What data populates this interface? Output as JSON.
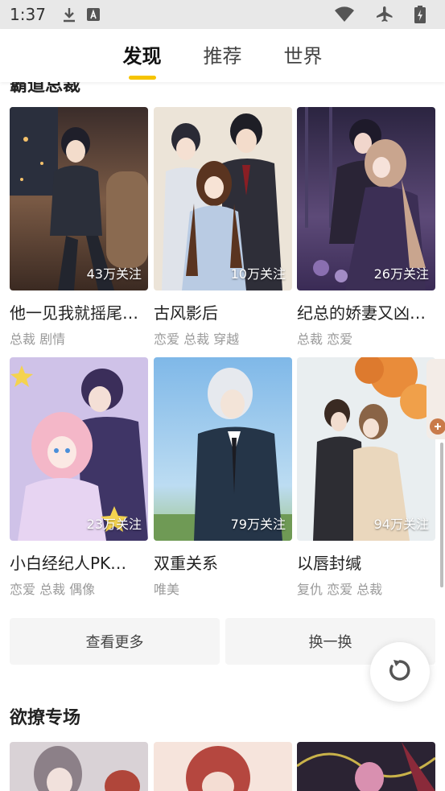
{
  "status_bar": {
    "time": "1:37"
  },
  "tabs": [
    {
      "label": "发现",
      "active": true
    },
    {
      "label": "推荐",
      "active": false
    },
    {
      "label": "世界",
      "active": false
    }
  ],
  "clipped_section_title": "霸道总裁",
  "cards": [
    {
      "title": "他一见我就摇尾…",
      "tags": "总裁 剧情",
      "follows": "43万关注"
    },
    {
      "title": "古风影后",
      "tags": "恋爱 总裁 穿越",
      "follows": "10万关注"
    },
    {
      "title": "纪总的娇妻又凶…",
      "tags": "总裁 恋爱",
      "follows": "26万关注"
    },
    {
      "title": "小白经纪人PK…",
      "tags": "恋爱 总裁 偶像",
      "follows": "23万关注"
    },
    {
      "title": "双重关系",
      "tags": "唯美",
      "follows": "79万关注"
    },
    {
      "title": "以唇封缄",
      "tags": "复仇 恋爱 总裁",
      "follows": "94万关注"
    }
  ],
  "buttons": {
    "more": "查看更多",
    "shuffle": "换一换"
  },
  "section2_title": "欲撩专场",
  "colors": {
    "accent": "#f6c400"
  }
}
